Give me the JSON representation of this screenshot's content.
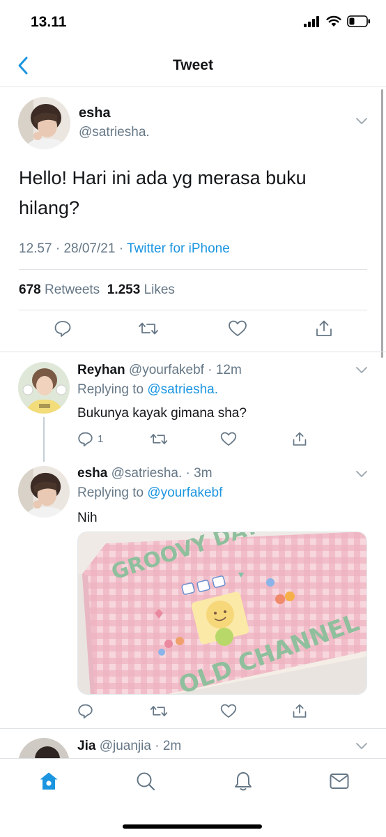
{
  "status": {
    "time": "13.11"
  },
  "nav": {
    "title": "Tweet"
  },
  "main_tweet": {
    "name": "esha",
    "handle": "@satriesha.",
    "text": "Hello! Hari ini ada yg merasa buku hilang?",
    "time": "12.57",
    "date": "28/07/21",
    "source": "Twitter for iPhone",
    "retweet_count": "678",
    "retweet_label": "Retweets",
    "like_count": "1.253",
    "like_label": "Likes"
  },
  "replies": [
    {
      "name": "Reyhan",
      "handle": "@yourfakebf",
      "time": "12m",
      "replying_prefix": "Replying to",
      "replying_to": "@satriesha.",
      "text": "Bukunya kayak gimana sha?",
      "reply_count": "1"
    },
    {
      "name": "esha",
      "handle": "@satriesha.",
      "time": "3m",
      "replying_prefix": "Replying to",
      "replying_to": "@yourfakebf",
      "text": "Nih",
      "image": {
        "title_top": "GROOVY DAYS",
        "title_bottom": "OLD CHANNEL"
      }
    },
    {
      "name": "Jia",
      "handle": "@juanjia",
      "time": "2m"
    }
  ],
  "icons": {
    "back": "chevron-left-icon",
    "reply": "reply-icon",
    "retweet": "retweet-icon",
    "like": "heart-icon",
    "share": "share-icon",
    "tabs": [
      "home-icon",
      "search-icon",
      "notifications-icon",
      "messages-icon"
    ]
  },
  "colors": {
    "accent": "#1b95e0",
    "secondary_text": "#657786",
    "divider": "#dfe3e6"
  }
}
